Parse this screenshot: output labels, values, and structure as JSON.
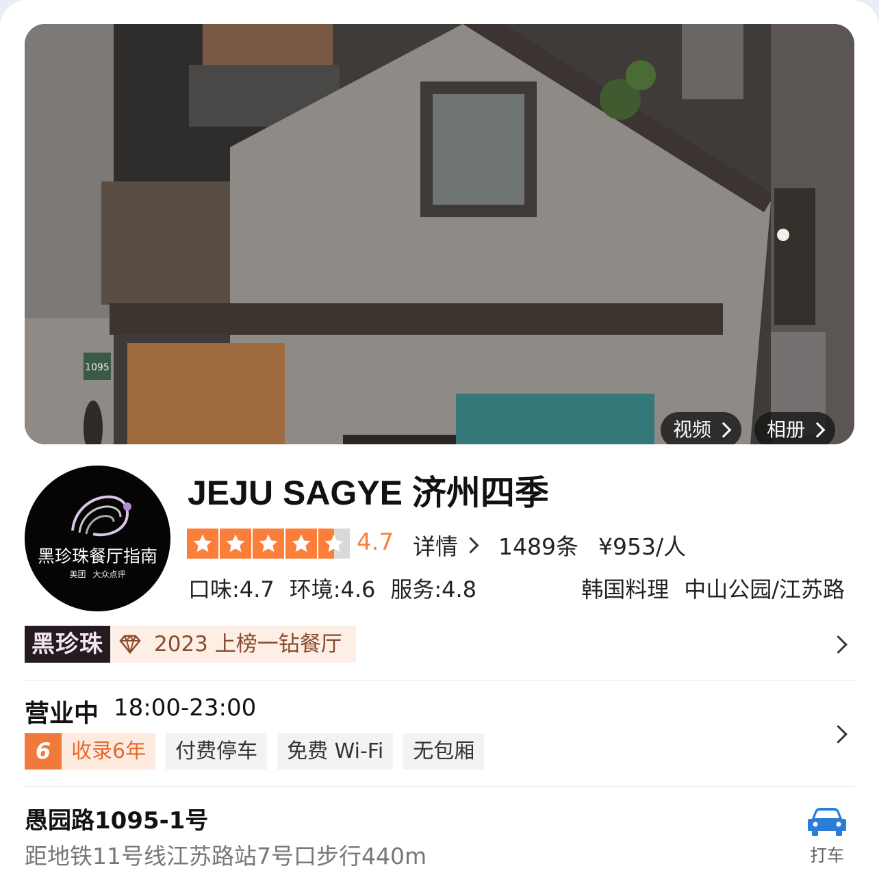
{
  "hero": {
    "house_number": "1095",
    "video_label": "视频",
    "album_label": "相册"
  },
  "logo": {
    "title": "黑珍珠餐厅指南",
    "brand1": "美团",
    "brand2": "大众点评"
  },
  "restaurant": {
    "name": "JEJU SAGYE 济州四季",
    "rating": "4.7",
    "rating_value": 4.7,
    "details_label": "详情",
    "review_count": "1489条",
    "price": "¥953/人",
    "scores": [
      "口味:4.7",
      "环境:4.6",
      "服务:4.8"
    ],
    "cuisine": "韩国料理",
    "area": "中山公园/江苏路"
  },
  "badge": {
    "brand": "黑珍珠",
    "award": "2023 上榜一钻餐厅"
  },
  "hours": {
    "status": "营业中",
    "time": "18:00-23:00"
  },
  "chips": {
    "years_num": "6",
    "years_text": "收录6年",
    "items": [
      "付费停车",
      "免费 Wi-Fi",
      "无包厢"
    ]
  },
  "address": {
    "line": "愚园路1095-1号",
    "metro": "距地铁11号线江苏路站7号口步行440m",
    "taxi_label": "打车"
  },
  "colors": {
    "accent": "#fb7f3a",
    "badge_dark": "#241a22",
    "taxi_blue": "#2a7ed8"
  }
}
